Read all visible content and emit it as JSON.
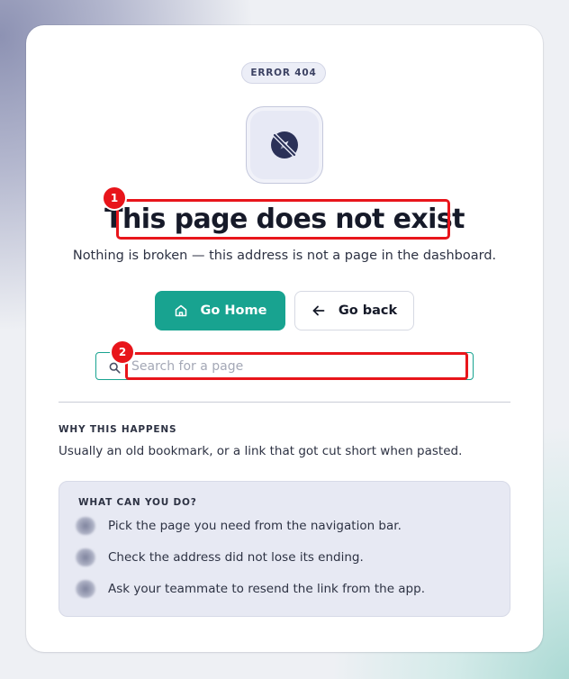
{
  "error_badge": "ERROR 404",
  "icon": "compass-off-icon",
  "title": "This page does not exist",
  "subtitle": "Nothing is broken — this address is not a page in the dashboard.",
  "actions": {
    "home_label": "Go Home",
    "home_icon": "home-icon",
    "back_label": "Go back",
    "back_icon": "arrow-left-icon"
  },
  "search": {
    "placeholder": "Search for a page",
    "value": ""
  },
  "why": {
    "heading": "WHY THIS HAPPENS",
    "text": "Usually an old bookmark, or a link that got cut short when pasted."
  },
  "tips": {
    "heading": "WHAT CAN YOU DO?",
    "items": [
      "Pick the page you need from the navigation bar.",
      "Check the address did not lose its ending.",
      "Ask your teammate to resend the link from the app."
    ]
  },
  "annotations": [
    "1",
    "2"
  ],
  "colors": {
    "accent": "#18a390",
    "annotation": "#e8151b",
    "title": "#161a29"
  }
}
